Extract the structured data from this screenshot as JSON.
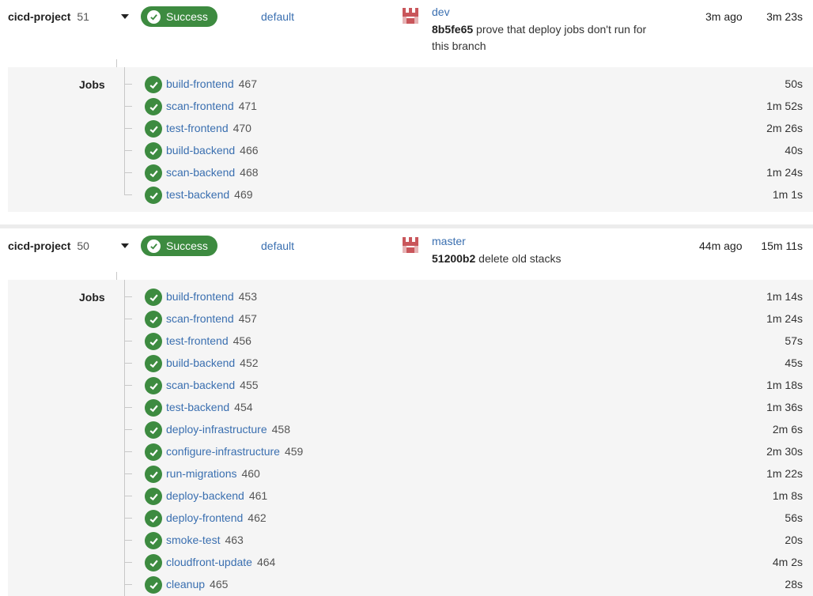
{
  "pipelines": [
    {
      "project": "cicd-project",
      "number": "51",
      "status": "Success",
      "branch": "default",
      "ref": "dev",
      "sha": "8b5fe65",
      "message_line1": "prove that deploy jobs don't run for",
      "message_line2": "this branch",
      "created": "3m ago",
      "duration": "3m 23s",
      "jobs_label": "Jobs",
      "jobs": [
        {
          "name": "build-frontend",
          "id": "467",
          "duration": "50s"
        },
        {
          "name": "scan-frontend",
          "id": "471",
          "duration": "1m 52s"
        },
        {
          "name": "test-frontend",
          "id": "470",
          "duration": "2m 26s"
        },
        {
          "name": "build-backend",
          "id": "466",
          "duration": "40s"
        },
        {
          "name": "scan-backend",
          "id": "468",
          "duration": "1m 24s"
        },
        {
          "name": "test-backend",
          "id": "469",
          "duration": "1m 1s"
        }
      ]
    },
    {
      "project": "cicd-project",
      "number": "50",
      "status": "Success",
      "branch": "default",
      "ref": "master",
      "sha": "51200b2",
      "message_line1": "delete old stacks",
      "message_line2": "",
      "created": "44m ago",
      "duration": "15m 11s",
      "jobs_label": "Jobs",
      "jobs": [
        {
          "name": "build-frontend",
          "id": "453",
          "duration": "1m 14s"
        },
        {
          "name": "scan-frontend",
          "id": "457",
          "duration": "1m 24s"
        },
        {
          "name": "test-frontend",
          "id": "456",
          "duration": "57s"
        },
        {
          "name": "build-backend",
          "id": "452",
          "duration": "45s"
        },
        {
          "name": "scan-backend",
          "id": "455",
          "duration": "1m 18s"
        },
        {
          "name": "test-backend",
          "id": "454",
          "duration": "1m 36s"
        },
        {
          "name": "deploy-infrastructure",
          "id": "458",
          "duration": "2m 6s"
        },
        {
          "name": "configure-infrastructure",
          "id": "459",
          "duration": "2m 30s"
        },
        {
          "name": "run-migrations",
          "id": "460",
          "duration": "1m 22s"
        },
        {
          "name": "deploy-backend",
          "id": "461",
          "duration": "1m 8s"
        },
        {
          "name": "deploy-frontend",
          "id": "462",
          "duration": "56s"
        },
        {
          "name": "smoke-test",
          "id": "463",
          "duration": "20s"
        },
        {
          "name": "cloudfront-update",
          "id": "464",
          "duration": "4m 2s"
        },
        {
          "name": "cleanup",
          "id": "465",
          "duration": "28s"
        }
      ]
    }
  ],
  "colors": {
    "success": "#3d8b40",
    "link": "#3a6fb0"
  },
  "icons": {
    "status": "check-circle-icon",
    "toggle": "caret-down-icon",
    "avatar": "avatar-icon"
  }
}
